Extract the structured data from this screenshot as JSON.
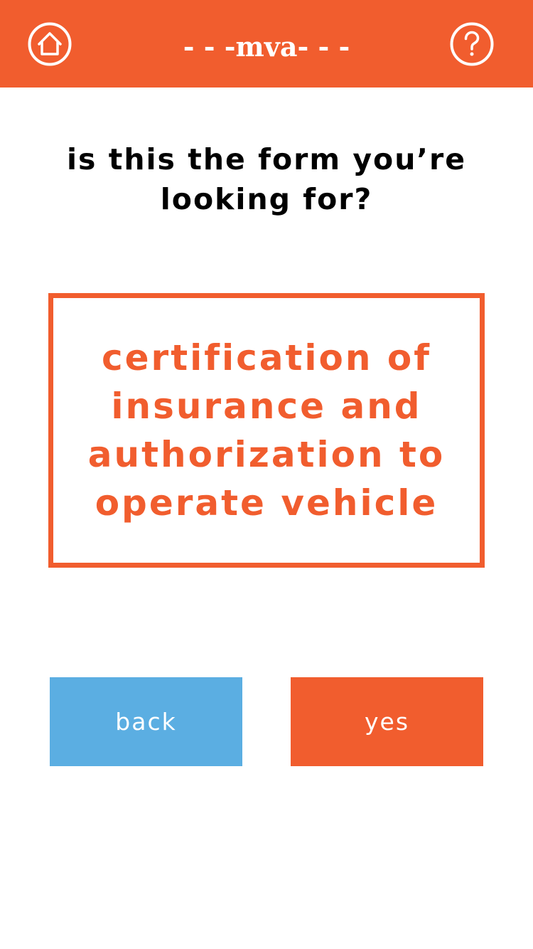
{
  "header": {
    "title": "- - -mva- - -",
    "home_icon": "home-icon",
    "help_icon": "help-icon"
  },
  "prompt": {
    "question": "is this the form you’re looking for?"
  },
  "form": {
    "name": "certification of insurance and authorization to operate vehicle"
  },
  "actions": {
    "back_label": "back",
    "yes_label": "yes"
  },
  "colors": {
    "brand_orange": "#F15D2E",
    "back_blue": "#5BAEE2",
    "background": "#FFFFFF"
  }
}
